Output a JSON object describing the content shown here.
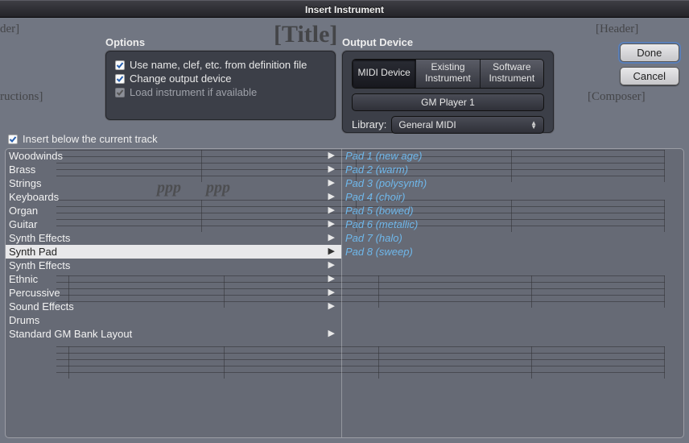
{
  "window": {
    "title": "Insert Instrument"
  },
  "bg": {
    "title": "[Title]",
    "header": "[Header]",
    "lheader": "der]",
    "composer": "[Composer]",
    "instructions": "ructions]",
    "dyn": "ppp"
  },
  "options": {
    "group_label": "Options",
    "use_definition": {
      "label": "Use name, clef, etc. from definition file",
      "checked": true
    },
    "change_output": {
      "label": "Change output device",
      "checked": true
    },
    "load_instrument": {
      "label": "Load instrument if available",
      "checked": true,
      "disabled": true
    }
  },
  "output": {
    "group_label": "Output Device",
    "segments": [
      "MIDI Device",
      "Existing Instrument",
      "Software Instrument"
    ],
    "active_segment": 0,
    "device": "GM Player 1",
    "library_label": "Library:",
    "library_value": "General MIDI"
  },
  "buttons": {
    "done": "Done",
    "cancel": "Cancel"
  },
  "below_track": {
    "label": "Insert below the current track",
    "checked": true
  },
  "categories": {
    "selected": 9,
    "items": [
      "Woodwinds",
      "Brass",
      "Strings",
      "Keyboards",
      "Organ",
      "Guitar",
      "Synth Effects",
      "Synth Pad",
      "Synth Effects",
      "Ethnic",
      "Percussive",
      "Sound Effects",
      "Drums",
      "Standard GM Bank Layout"
    ],
    "has_submenu": [
      true,
      true,
      true,
      true,
      true,
      true,
      true,
      true,
      true,
      true,
      true,
      true,
      false,
      true
    ]
  },
  "instruments": {
    "items": [
      "Pad 1 (new age)",
      "Pad 2 (warm)",
      "Pad 3 (polysynth)",
      "Pad 4 (choir)",
      "Pad 5 (bowed)",
      "Pad 6 (metallic)",
      "Pad 7 (halo)",
      "Pad 8 (sweep)"
    ]
  }
}
